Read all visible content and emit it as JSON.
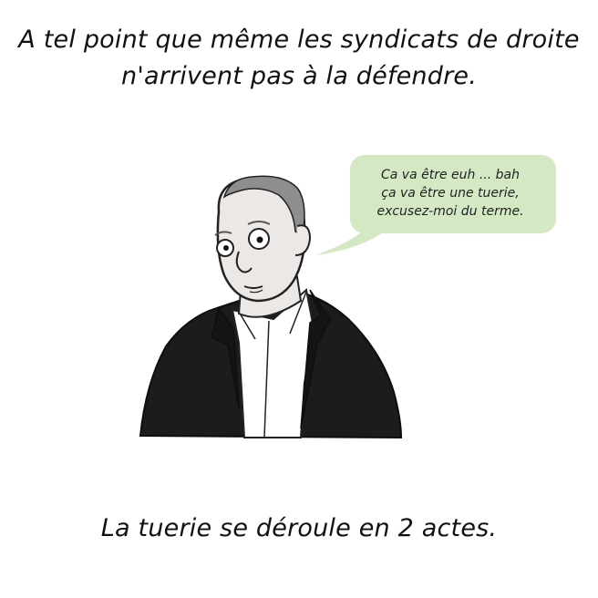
{
  "caption_top": {
    "line1": "A tel point que même les syndicats de droite",
    "line2": "n'arrivent pas à la défendre."
  },
  "speech_bubble": {
    "line1": "Ca va être euh ... bah",
    "line2": "ça va être une tuerie,",
    "line3": "excusez-moi du terme."
  },
  "caption_bottom": "La tuerie se déroule en 2 actes.",
  "colors": {
    "bubble": "#d4e8c4",
    "jacket": "#1c1c1c",
    "skin": "#ece8e6",
    "hair": "#8e8e8e",
    "shirt": "#ffffff"
  }
}
